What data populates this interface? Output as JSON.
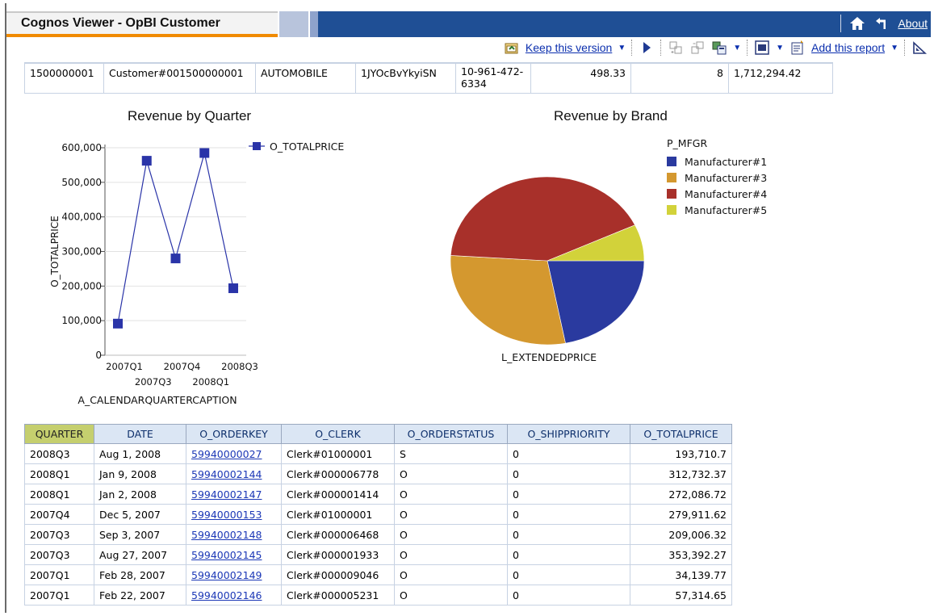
{
  "header": {
    "title": "Cognos Viewer - OpBI Customer",
    "about": "About"
  },
  "toolbar": {
    "keep_version": "Keep this version",
    "add_report": "Add this report"
  },
  "customer": [
    "1500000001",
    "Customer#001500000001",
    "AUTOMOBILE",
    "1JYOcBvYkyiSN",
    "10-961-472-\n6334",
    "498.33",
    "8",
    "1,712,294.42"
  ],
  "chart_data": [
    {
      "type": "line",
      "title": "Revenue by Quarter",
      "xlabel": "A_CALENDARQUARTERCAPTION",
      "ylabel": "O_TOTALPRICE",
      "categories": [
        "2007Q1",
        "2007Q3",
        "2007Q4",
        "2008Q1",
        "2008Q3"
      ],
      "series": [
        {
          "name": "O_TOTALPRICE",
          "values": [
            91454,
            562398,
            279912,
            584819,
            193711
          ]
        }
      ],
      "ylim": [
        0,
        600000
      ],
      "yticks": [
        "0",
        "100,000",
        "200,000",
        "300,000",
        "400,000",
        "500,000",
        "600,000"
      ],
      "xtick_row1": [
        "2007Q1",
        "2007Q4",
        "2008Q3"
      ],
      "xtick_row2": [
        "2007Q3",
        "2008Q1"
      ],
      "legend": "right",
      "color": "#2a34a8"
    },
    {
      "type": "pie",
      "title": "Revenue by Brand",
      "legend_title": "P_MFGR",
      "xlabel": "L_EXTENDEDPRICE",
      "slices": [
        {
          "name": "Manufacturer#1",
          "value": 22,
          "color": "#2a3a9f"
        },
        {
          "name": "Manufacturer#3",
          "value": 29,
          "color": "#d4982f"
        },
        {
          "name": "Manufacturer#4",
          "value": 42,
          "color": "#a8302a"
        },
        {
          "name": "Manufacturer#5",
          "value": 7,
          "color": "#d2d23a"
        }
      ]
    }
  ],
  "orders": {
    "columns": [
      "QUARTER",
      "DATE",
      "O_ORDERKEY",
      "O_CLERK",
      "O_ORDERSTATUS",
      "O_SHIPPRIORITY",
      "O_TOTALPRICE"
    ],
    "rows": [
      [
        "2008Q3",
        "Aug 1, 2008",
        "59940000027",
        "Clerk#01000001",
        "S",
        "0",
        "193,710.7"
      ],
      [
        "2008Q1",
        "Jan 9, 2008",
        "59940002144",
        "Clerk#000006778",
        "O",
        "0",
        "312,732.37"
      ],
      [
        "2008Q1",
        "Jan 2, 2008",
        "59940002147",
        "Clerk#000001414",
        "O",
        "0",
        "272,086.72"
      ],
      [
        "2007Q4",
        "Dec 5, 2007",
        "59940000153",
        "Clerk#01000001",
        "O",
        "0",
        "279,911.62"
      ],
      [
        "2007Q3",
        "Sep 3, 2007",
        "59940002148",
        "Clerk#000006468",
        "O",
        "0",
        "209,006.32"
      ],
      [
        "2007Q3",
        "Aug 27, 2007",
        "59940002145",
        "Clerk#000001933",
        "O",
        "0",
        "353,392.27"
      ],
      [
        "2007Q1",
        "Feb 28, 2007",
        "59940002149",
        "Clerk#000009046",
        "O",
        "0",
        "34,139.77"
      ],
      [
        "2007Q1",
        "Feb 22, 2007",
        "59940002146",
        "Clerk#000005231",
        "O",
        "0",
        "57,314.65"
      ]
    ]
  }
}
